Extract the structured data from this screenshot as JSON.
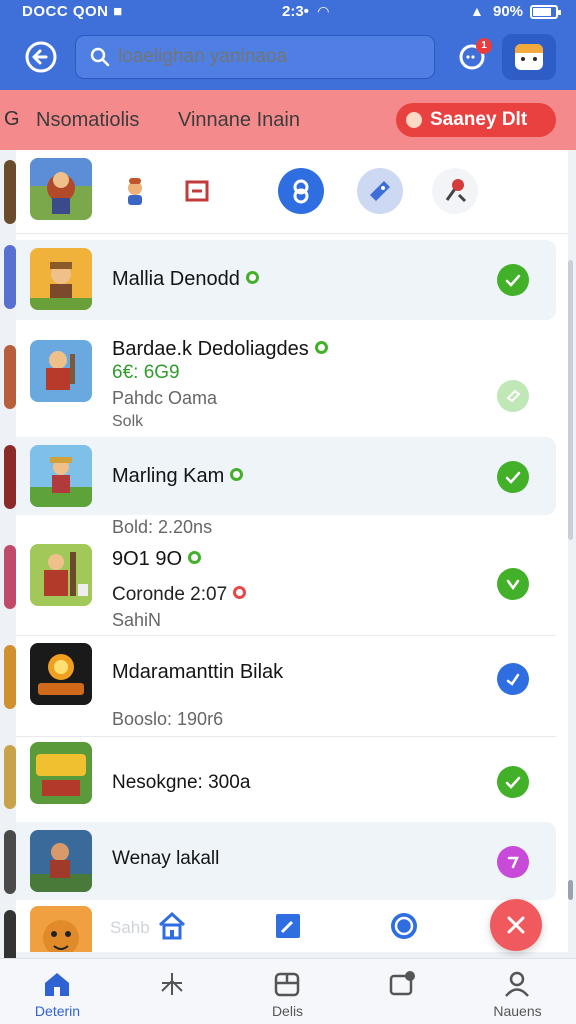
{
  "status_bar": {
    "carrier": "DOCC QON ■",
    "time": "2:3•",
    "battery": "90%"
  },
  "header": {
    "search_placeholder": "loaelighan yaninaoa",
    "notification_count": "1"
  },
  "banner": {
    "left_edge": "G",
    "filter_1": "Nsomatiolis",
    "filter_2": "Vinnane Inain",
    "cta": "Saaney  Dlt"
  },
  "quick_icons": [
    "person-icon",
    "gift-icon",
    "location-pin-icon",
    "ticket-icon",
    "tools-icon"
  ],
  "games": [
    {
      "title": "Mallia Denodd",
      "status": "complete"
    },
    {
      "title": "Bardae.k Dedoliagdes",
      "line1": "6€: 6G9",
      "line2": "Pahdc Oama",
      "line3": "Solk",
      "status": "faded"
    },
    {
      "title": "Marling Kam",
      "line1": "Bold: 2.20ns",
      "status": "complete"
    },
    {
      "title": "9O1 9O",
      "line1": "Coronde 2:07",
      "line2": "SahiN",
      "status": "download"
    },
    {
      "title": "Mdaramanttin Bilak",
      "line1": "Booslo: 190r6",
      "status": "info"
    },
    {
      "title": "Nesokgne: 300a",
      "status": "complete"
    },
    {
      "title": "Wenay lakall",
      "status": "pending"
    }
  ],
  "peek_text": "Sahb",
  "bottom_nav": [
    {
      "label": "Deterin",
      "icon": "home-icon",
      "active": true
    },
    {
      "label": "",
      "icon": "sparkle-icon",
      "active": false
    },
    {
      "label": "Delis",
      "icon": "calendar-icon",
      "active": false
    },
    {
      "label": "",
      "icon": "inbox-icon",
      "active": false
    },
    {
      "label": "Nauens",
      "icon": "profile-icon",
      "active": false
    }
  ],
  "colors": {
    "primary": "#3f6fd8",
    "banner": "#f58a8c",
    "accent_red": "#e9413f",
    "success": "#43b02a",
    "info": "#2f63d3",
    "pending": "#c84ad8"
  }
}
